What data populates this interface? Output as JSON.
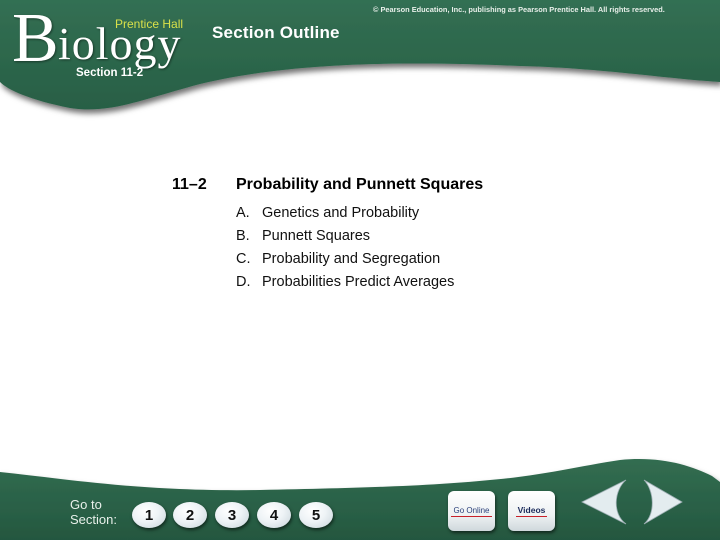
{
  "header": {
    "logo_initial": "B",
    "logo_rest": "iology",
    "publisher": "Prentice Hall",
    "page_title": "Section Outline",
    "copyright": "© Pearson Education, Inc., publishing as Pearson Prentice Hall. All rights reserved.",
    "section_label": "Section 11-2"
  },
  "outline": {
    "number": "11–2",
    "heading": "Probability and Punnett Squares",
    "items": [
      {
        "letter": "A.",
        "text": "Genetics and Probability"
      },
      {
        "letter": "B.",
        "text": "Punnett Squares"
      },
      {
        "letter": "C.",
        "text": "Probability and Segregation"
      },
      {
        "letter": "D.",
        "text": "Probabilities Predict Averages"
      }
    ]
  },
  "footer": {
    "goto_line1": "Go to",
    "goto_line2": "Section:",
    "section_buttons": [
      "1",
      "2",
      "3",
      "4",
      "5"
    ],
    "go_online_label": "Go Online",
    "videos_label": "Videos",
    "prev_icon": "left-arrow-icon",
    "next_icon": "right-arrow-icon"
  },
  "colors": {
    "banner_green": "#2f6b4f",
    "banner_green_dark": "#235840",
    "publisher_yellow": "#d8e04a",
    "button_face": "#eef3f6"
  }
}
